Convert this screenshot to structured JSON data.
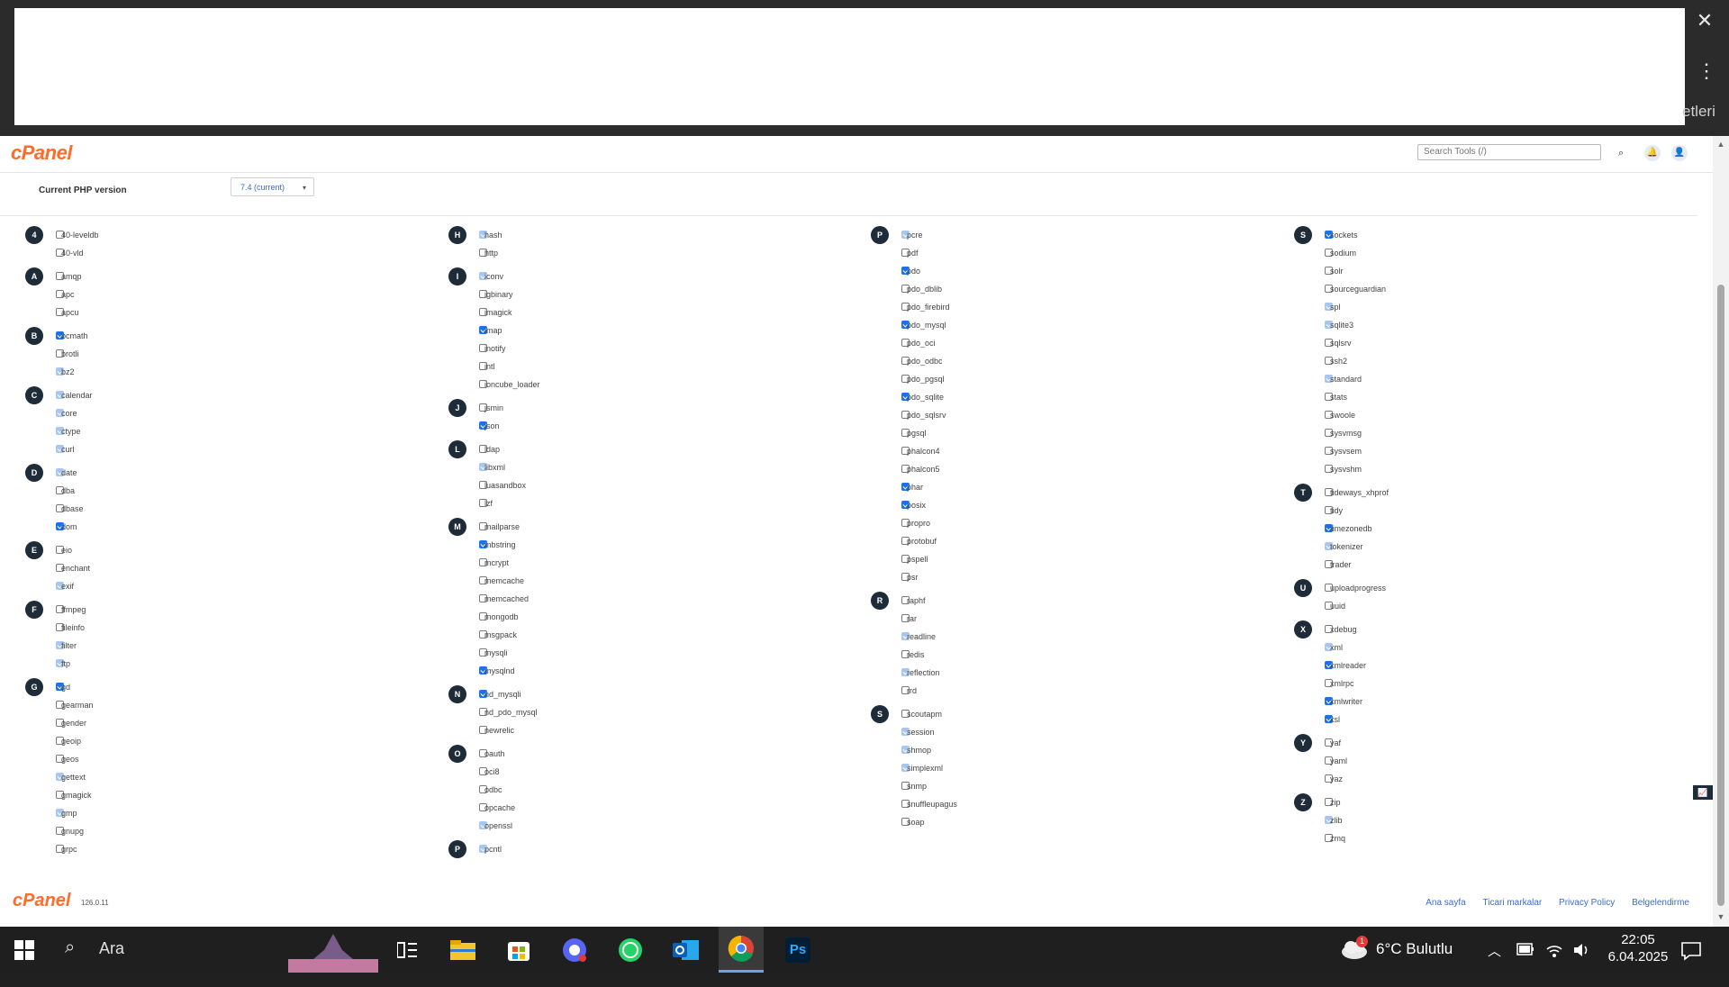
{
  "browser": {
    "side_fragment": "etleri",
    "close_icon": "close-icon",
    "menu_icon": "kebab-menu-icon"
  },
  "cpanel": {
    "logo": "cPanel",
    "search_placeholder": "Search Tools (/)",
    "php_version_label": "Current PHP version",
    "php_version_value": "7.4 (current)",
    "columns": [
      [
        {
          "letter": "4",
          "items": [
            [
              "40-leveldb",
              "off"
            ],
            [
              "40-vld",
              "off"
            ]
          ]
        },
        {
          "letter": "A",
          "items": [
            [
              "amqp",
              "off"
            ],
            [
              "apc",
              "off"
            ],
            [
              "apcu",
              "off"
            ]
          ]
        },
        {
          "letter": "B",
          "items": [
            [
              "bcmath",
              "on"
            ],
            [
              "brotli",
              "off"
            ],
            [
              "bz2",
              "dis"
            ]
          ]
        },
        {
          "letter": "C",
          "items": [
            [
              "calendar",
              "dis"
            ],
            [
              "core",
              "dis"
            ],
            [
              "ctype",
              "dis"
            ],
            [
              "curl",
              "dis"
            ]
          ]
        },
        {
          "letter": "D",
          "items": [
            [
              "date",
              "dis"
            ],
            [
              "dba",
              "off"
            ],
            [
              "dbase",
              "off"
            ],
            [
              "dom",
              "on"
            ]
          ]
        },
        {
          "letter": "E",
          "items": [
            [
              "eio",
              "off"
            ],
            [
              "enchant",
              "off"
            ],
            [
              "exif",
              "dis"
            ]
          ]
        },
        {
          "letter": "F",
          "items": [
            [
              "ffmpeg",
              "off"
            ],
            [
              "fileinfo",
              "off"
            ],
            [
              "filter",
              "dis"
            ],
            [
              "ftp",
              "dis"
            ]
          ]
        },
        {
          "letter": "G",
          "items": [
            [
              "gd",
              "on"
            ],
            [
              "gearman",
              "off"
            ],
            [
              "gender",
              "off"
            ],
            [
              "geoip",
              "off"
            ],
            [
              "geos",
              "off"
            ],
            [
              "gettext",
              "dis"
            ],
            [
              "gmagick",
              "off"
            ],
            [
              "gmp",
              "dis"
            ],
            [
              "gnupg",
              "off"
            ],
            [
              "grpc",
              "off"
            ]
          ]
        }
      ],
      [
        {
          "letter": "H",
          "items": [
            [
              "hash",
              "dis"
            ],
            [
              "http",
              "off"
            ]
          ]
        },
        {
          "letter": "I",
          "items": [
            [
              "iconv",
              "dis"
            ],
            [
              "igbinary",
              "off"
            ],
            [
              "imagick",
              "off"
            ],
            [
              "imap",
              "on"
            ],
            [
              "inotify",
              "off"
            ],
            [
              "intl",
              "off"
            ],
            [
              "ioncube_loader",
              "off"
            ]
          ]
        },
        {
          "letter": "J",
          "items": [
            [
              "jsmin",
              "off"
            ],
            [
              "json",
              "on"
            ]
          ]
        },
        {
          "letter": "L",
          "items": [
            [
              "ldap",
              "off"
            ],
            [
              "libxml",
              "dis"
            ],
            [
              "luasandbox",
              "off"
            ],
            [
              "lzf",
              "off"
            ]
          ]
        },
        {
          "letter": "M",
          "items": [
            [
              "mailparse",
              "off"
            ],
            [
              "mbstring",
              "on"
            ],
            [
              "mcrypt",
              "off"
            ],
            [
              "memcache",
              "off"
            ],
            [
              "memcached",
              "off"
            ],
            [
              "mongodb",
              "off"
            ],
            [
              "msgpack",
              "off"
            ],
            [
              "mysqli",
              "off"
            ],
            [
              "mysqlnd",
              "on"
            ]
          ]
        },
        {
          "letter": "N",
          "items": [
            [
              "nd_mysqli",
              "on"
            ],
            [
              "nd_pdo_mysql",
              "off"
            ],
            [
              "newrelic",
              "off"
            ]
          ]
        },
        {
          "letter": "O",
          "items": [
            [
              "oauth",
              "off"
            ],
            [
              "oci8",
              "off"
            ],
            [
              "odbc",
              "off"
            ],
            [
              "opcache",
              "off"
            ],
            [
              "openssl",
              "dis"
            ]
          ]
        },
        {
          "letter": "P",
          "items": [
            [
              "pcntl",
              "dis"
            ]
          ]
        }
      ],
      [
        {
          "letter": "P",
          "items": [
            [
              "pcre",
              "dis"
            ],
            [
              "pdf",
              "off"
            ],
            [
              "pdo",
              "on"
            ],
            [
              "pdo_dblib",
              "off"
            ],
            [
              "pdo_firebird",
              "off"
            ],
            [
              "pdo_mysql",
              "on"
            ],
            [
              "pdo_oci",
              "off"
            ],
            [
              "pdo_odbc",
              "off"
            ],
            [
              "pdo_pgsql",
              "off"
            ],
            [
              "pdo_sqlite",
              "on"
            ],
            [
              "pdo_sqlsrv",
              "off"
            ],
            [
              "pgsql",
              "off"
            ],
            [
              "phalcon4",
              "off"
            ],
            [
              "phalcon5",
              "off"
            ],
            [
              "phar",
              "on"
            ],
            [
              "posix",
              "on"
            ],
            [
              "propro",
              "off"
            ],
            [
              "protobuf",
              "off"
            ],
            [
              "pspell",
              "off"
            ],
            [
              "psr",
              "off"
            ]
          ]
        },
        {
          "letter": "R",
          "items": [
            [
              "raphf",
              "off"
            ],
            [
              "rar",
              "off"
            ],
            [
              "readline",
              "dis"
            ],
            [
              "redis",
              "off"
            ],
            [
              "reflection",
              "dis"
            ],
            [
              "rrd",
              "off"
            ]
          ]
        },
        {
          "letter": "S",
          "items": [
            [
              "scoutapm",
              "off"
            ],
            [
              "session",
              "dis"
            ],
            [
              "shmop",
              "dis"
            ],
            [
              "simplexml",
              "dis"
            ],
            [
              "snmp",
              "off"
            ],
            [
              "snuffleupagus",
              "off"
            ],
            [
              "soap",
              "off"
            ]
          ]
        }
      ],
      [
        {
          "letter": "S",
          "items": [
            [
              "sockets",
              "on"
            ],
            [
              "sodium",
              "off"
            ],
            [
              "solr",
              "off"
            ],
            [
              "sourceguardian",
              "off"
            ],
            [
              "spl",
              "dis"
            ],
            [
              "sqlite3",
              "dis"
            ],
            [
              "sqlsrv",
              "off"
            ],
            [
              "ssh2",
              "off"
            ],
            [
              "standard",
              "dis"
            ],
            [
              "stats",
              "off"
            ],
            [
              "swoole",
              "off"
            ],
            [
              "sysvmsg",
              "off"
            ],
            [
              "sysvsem",
              "off"
            ],
            [
              "sysvshm",
              "off"
            ]
          ]
        },
        {
          "letter": "T",
          "items": [
            [
              "tideways_xhprof",
              "off"
            ],
            [
              "tidy",
              "off"
            ],
            [
              "timezonedb",
              "on"
            ],
            [
              "tokenizer",
              "dis"
            ],
            [
              "trader",
              "off"
            ]
          ]
        },
        {
          "letter": "U",
          "items": [
            [
              "uploadprogress",
              "off"
            ],
            [
              "uuid",
              "off"
            ]
          ]
        },
        {
          "letter": "X",
          "items": [
            [
              "xdebug",
              "off"
            ],
            [
              "xml",
              "dis"
            ],
            [
              "xmlreader",
              "on"
            ],
            [
              "xmlrpc",
              "off"
            ],
            [
              "xmlwriter",
              "on"
            ],
            [
              "xsl",
              "on"
            ]
          ]
        },
        {
          "letter": "Y",
          "items": [
            [
              "yaf",
              "off"
            ],
            [
              "yaml",
              "off"
            ],
            [
              "yaz",
              "off"
            ]
          ]
        },
        {
          "letter": "Z",
          "items": [
            [
              "zip",
              "off"
            ],
            [
              "zlib",
              "dis"
            ],
            [
              "zmq",
              "off"
            ]
          ]
        }
      ]
    ],
    "footer": {
      "logo": "cPanel",
      "version": "126.0.11",
      "links": [
        "Ana sayfa",
        "Ticari markalar",
        "Privacy Policy",
        "Belgelendirme"
      ]
    }
  },
  "taskbar": {
    "search_label": "Ara",
    "weather": "6°C Bulutlu",
    "weather_badge": "1",
    "time": "22:05",
    "date": "6.04.2025",
    "apps": [
      "task-view-icon",
      "file-explorer-icon",
      "microsoft-store-icon",
      "app-icon",
      "whatsapp-icon",
      "outlook-icon",
      "chrome-icon",
      "photoshop-icon"
    ],
    "photoshop_label": "Ps"
  }
}
